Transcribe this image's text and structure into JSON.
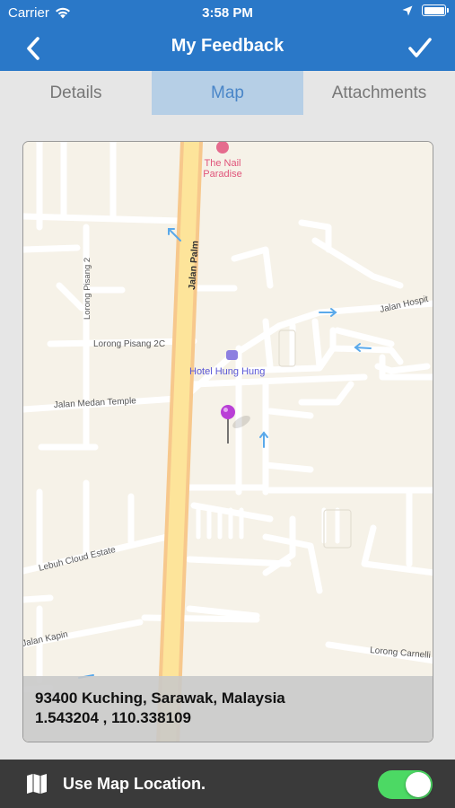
{
  "status_bar": {
    "carrier": "Carrier",
    "time": "3:58 PM"
  },
  "nav": {
    "title": "My Feedback",
    "back_icon": "chevron-left-icon",
    "done_icon": "checkmark-icon"
  },
  "tabs": [
    {
      "label": "Details",
      "active": false
    },
    {
      "label": "Map",
      "active": true
    },
    {
      "label": "Attachments",
      "active": false
    }
  ],
  "map": {
    "labels": {
      "poi_top": [
        "The Nail",
        "Paradise"
      ],
      "jalan_palm": "Jalan Palm",
      "jalan_hospital": "Jalan Hospit",
      "lorong_pisang_2": "Lorong Pisang 2",
      "lorong_pisang_2c": "Lorong Pisang 2C",
      "hotel": "Hotel Hung Hung",
      "jalan_medan_temple": "Jalan Medan Temple",
      "lebuh_cloud_estate": "Lebuh Cloud Estate",
      "jalan_kapin": "Jalan Kapin",
      "lorong_carnell": "Lorong Carnelli"
    },
    "address": "93400 Kuching, Sarawak, Malaysia",
    "coordinates": "1.543204 , 110.338109"
  },
  "bottom_bar": {
    "label": "Use Map Location.",
    "toggle_on": true
  },
  "colors": {
    "primary": "#2a78c8",
    "tab_active_bg": "#b6cfe6",
    "toggle_on": "#4cd964",
    "pin": "#b93fd6"
  }
}
